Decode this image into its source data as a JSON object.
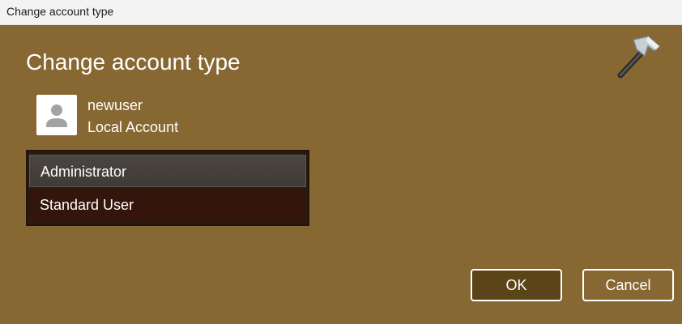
{
  "window": {
    "title": "Change account type"
  },
  "dialog": {
    "heading": "Change account type",
    "app_icon": "hammer-icon"
  },
  "user": {
    "avatar_icon": "user-avatar-icon",
    "name": "newuser",
    "account_type": "Local Account"
  },
  "account_type_list": {
    "options": [
      {
        "label": "Administrator",
        "selected": true
      },
      {
        "label": "Standard User",
        "selected": false
      }
    ]
  },
  "buttons": {
    "ok_label": "OK",
    "cancel_label": "Cancel"
  },
  "colors": {
    "accent_background": "#876833",
    "list_background": "#33150b",
    "selected_option": "#4a4541",
    "ok_button": "#5a4418"
  }
}
